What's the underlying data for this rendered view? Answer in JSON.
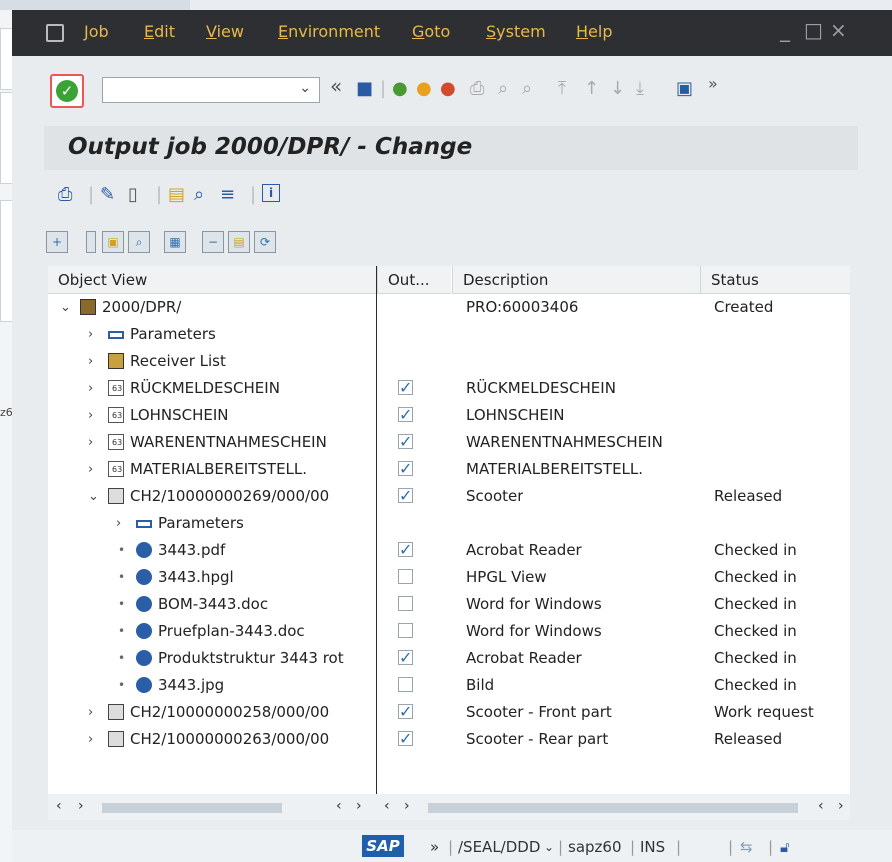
{
  "menu": [
    "Job",
    "Edit",
    "View",
    "Environment",
    "Goto",
    "System",
    "Help"
  ],
  "window_controls": {
    "minimize": "_",
    "maximize": "□",
    "close": "×"
  },
  "toolbar": {
    "more": "»",
    "back": "«"
  },
  "title": "Output job 2000/DPR/ - Change",
  "headers": [
    "Object View",
    "Out...",
    "Description",
    "Status"
  ],
  "rows": [
    {
      "level": 0,
      "exp": "open",
      "icon": "job-icon",
      "obj": "2000/DPR/",
      "out": null,
      "desc": "PRO:60003406",
      "status": "Created"
    },
    {
      "level": 1,
      "exp": "closed",
      "icon": "parameters-icon",
      "obj": "Parameters",
      "out": null,
      "desc": "",
      "status": ""
    },
    {
      "level": 1,
      "exp": "closed",
      "icon": "receiver-list-icon",
      "obj": "Receiver List",
      "out": null,
      "desc": "",
      "status": ""
    },
    {
      "level": 1,
      "exp": "closed",
      "icon": "document-icon",
      "obj": "RÜCKMELDESCHEIN",
      "out": true,
      "desc": "RÜCKMELDESCHEIN",
      "status": ""
    },
    {
      "level": 1,
      "exp": "closed",
      "icon": "document-icon",
      "obj": "LOHNSCHEIN",
      "out": true,
      "desc": "LOHNSCHEIN",
      "status": ""
    },
    {
      "level": 1,
      "exp": "closed",
      "icon": "document-icon",
      "obj": "WARENENTNAHMESCHEIN",
      "out": true,
      "desc": "WARENENTNAHMESCHEIN",
      "status": ""
    },
    {
      "level": 1,
      "exp": "closed",
      "icon": "document-icon",
      "obj": "MATERIALBEREITSTELL.",
      "out": true,
      "desc": "MATERIALBEREITSTELL.",
      "status": ""
    },
    {
      "level": 1,
      "exp": "open",
      "icon": "dis-document-icon",
      "obj": "CH2/10000000269/000/00",
      "out": true,
      "desc": "Scooter",
      "status": "Released"
    },
    {
      "level": 2,
      "exp": "closed",
      "icon": "parameters-icon",
      "obj": "Parameters",
      "out": null,
      "desc": "",
      "status": ""
    },
    {
      "level": 2,
      "exp": "leaf",
      "icon": "original-icon",
      "obj": "3443.pdf",
      "out": true,
      "desc": "Acrobat Reader",
      "status": "Checked in"
    },
    {
      "level": 2,
      "exp": "leaf",
      "icon": "original-icon",
      "obj": "3443.hpgl",
      "out": false,
      "desc": "HPGL View",
      "status": "Checked in"
    },
    {
      "level": 2,
      "exp": "leaf",
      "icon": "original-icon",
      "obj": "BOM-3443.doc",
      "out": false,
      "desc": "Word for Windows",
      "status": "Checked in"
    },
    {
      "level": 2,
      "exp": "leaf",
      "icon": "original-icon",
      "obj": "Pruefplan-3443.doc",
      "out": false,
      "desc": "Word for Windows",
      "status": "Checked in"
    },
    {
      "level": 2,
      "exp": "leaf",
      "icon": "original-icon",
      "obj": "Produktstruktur 3443 rot",
      "out": true,
      "desc": "Acrobat Reader",
      "status": "Checked in"
    },
    {
      "level": 2,
      "exp": "leaf",
      "icon": "original-icon",
      "obj": "3443.jpg",
      "out": false,
      "desc": "Bild",
      "status": "Checked in"
    },
    {
      "level": 1,
      "exp": "closed",
      "icon": "dis-document-icon",
      "obj": "CH2/10000000258/000/00",
      "out": true,
      "desc": "Scooter - Front part",
      "status": "Work request"
    },
    {
      "level": 1,
      "exp": "closed",
      "icon": "dis-document-icon",
      "obj": "CH2/10000000263/000/00",
      "out": true,
      "desc": "Scooter - Rear part",
      "status": "Released"
    }
  ],
  "status_bar": {
    "sap": "SAP",
    "more": "»",
    "transaction": "/SEAL/DDD",
    "system": "sapz60",
    "mode": "INS"
  },
  "background_text": "z6",
  "colors": {
    "menubar": "#2d2f33",
    "menu_text": "#e8b94a",
    "accent": "#2b6fb0"
  }
}
